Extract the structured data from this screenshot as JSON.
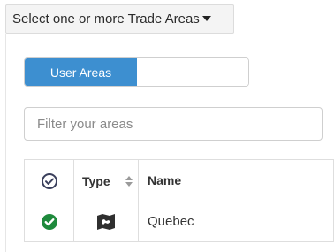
{
  "dropdown": {
    "label": "Select one or more Trade Areas",
    "icon": "caret-down-icon"
  },
  "toggle": {
    "active_label": "User Areas",
    "inactive_label": ""
  },
  "filter": {
    "placeholder": "Filter your areas",
    "value": ""
  },
  "table": {
    "columns": [
      {
        "key": "select",
        "label": "",
        "icon": "check-circle-outline-icon"
      },
      {
        "key": "type",
        "label": "Type",
        "sortable": true
      },
      {
        "key": "name",
        "label": "Name"
      }
    ],
    "rows": [
      {
        "selected": true,
        "type_icon": "map-icon",
        "name": "Quebec"
      }
    ]
  },
  "colors": {
    "accent": "#3d8fd0",
    "selected_green": "#1e8a3c",
    "header_check": "#3a3f5c"
  }
}
